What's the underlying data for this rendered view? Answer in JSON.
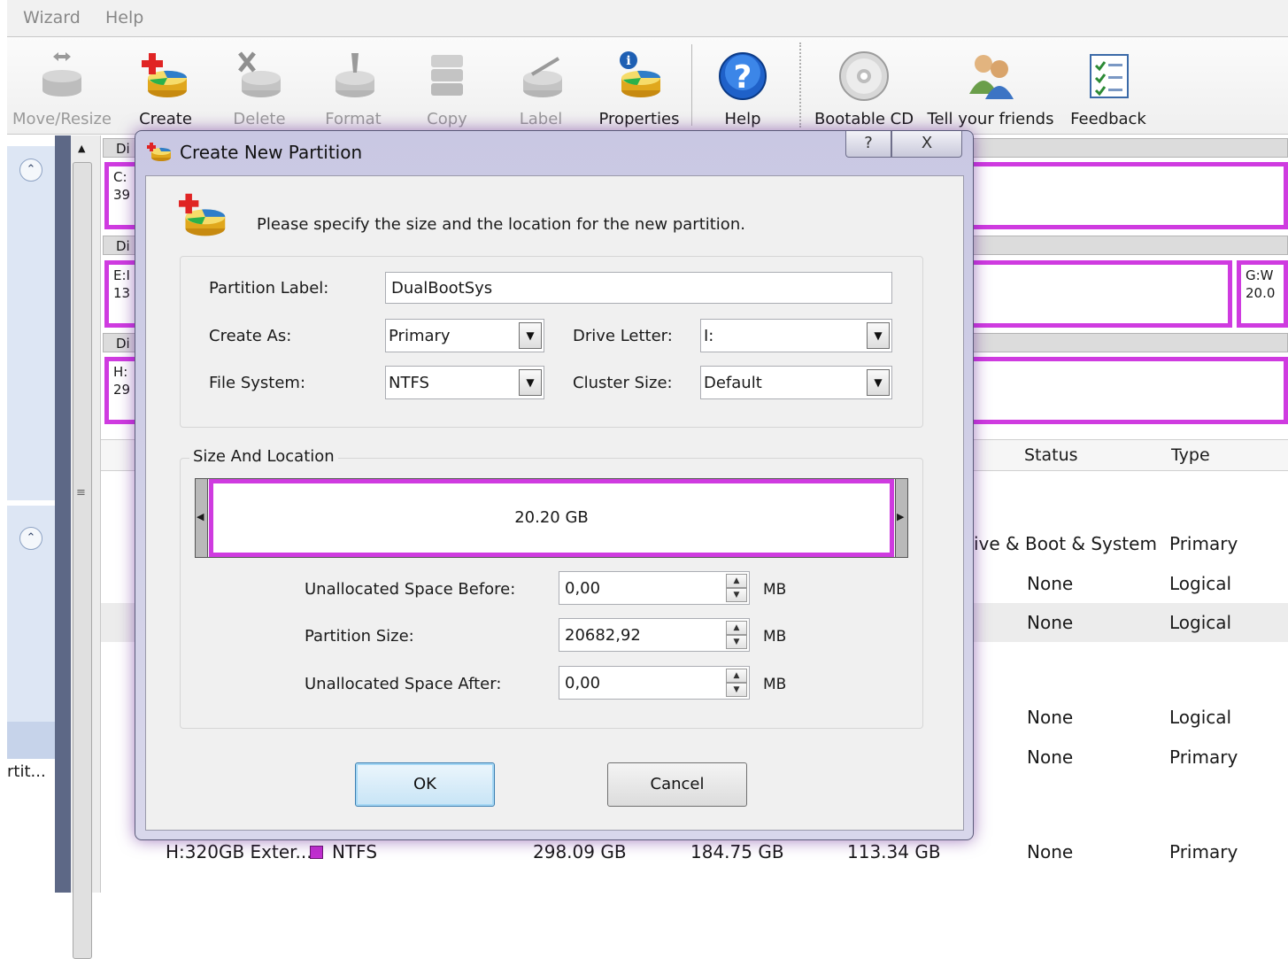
{
  "menubar": {
    "items": [
      "Wizard",
      "Help"
    ]
  },
  "toolbar": {
    "buttons": [
      {
        "label": "Move/Resize",
        "icon": "move-resize-icon",
        "enabled": false
      },
      {
        "label": "Create",
        "icon": "create-partition-icon",
        "enabled": true
      },
      {
        "label": "Delete",
        "icon": "delete-partition-icon",
        "enabled": false
      },
      {
        "label": "Format",
        "icon": "format-partition-icon",
        "enabled": false
      },
      {
        "label": "Copy",
        "icon": "copy-partition-icon",
        "enabled": false
      },
      {
        "label": "Label",
        "icon": "label-partition-icon",
        "enabled": false
      },
      {
        "label": "Properties",
        "icon": "properties-icon",
        "enabled": true
      },
      {
        "label": "Help",
        "icon": "help-icon",
        "enabled": true
      },
      {
        "label": "Bootable CD",
        "icon": "cd-icon",
        "enabled": true
      },
      {
        "label": "Tell your friends",
        "icon": "friends-icon",
        "enabled": true
      },
      {
        "label": "Feedback",
        "icon": "feedback-icon",
        "enabled": true
      }
    ]
  },
  "disk_map": {
    "headers": [
      "Di",
      "Di",
      "Di"
    ],
    "partitions": [
      {
        "line1": "C:",
        "line2": "39"
      },
      {
        "line1": "E:I",
        "line2": "13"
      },
      {
        "line1": "G:W",
        "line2": "20.0"
      },
      {
        "line1": "H:",
        "line2": "29"
      }
    ]
  },
  "left_panel": {
    "truncated_label": "rtit..."
  },
  "partition_list": {
    "columns": {
      "status": "Status",
      "type": "Type"
    },
    "rows": [
      {
        "status": "ive & Boot & System",
        "type": "Primary"
      },
      {
        "status": "None",
        "type": "Logical"
      },
      {
        "status": "None",
        "type": "Logical"
      },
      {
        "status": "None",
        "type": "Logical"
      },
      {
        "status": "None",
        "type": "Primary"
      }
    ],
    "last_row": {
      "name": "H:320GB Exter...",
      "fs": "NTFS",
      "capacity": "298.09 GB",
      "used": "184.75 GB",
      "unused": "113.34 GB",
      "status": "None",
      "type": "Primary"
    }
  },
  "dialog": {
    "title": "Create New Partition",
    "help_glyph": "?",
    "close_glyph": "X",
    "instruction": "Please specify the size and the location for the new partition.",
    "fields": {
      "partition_label": {
        "label": "Partition Label:",
        "value": "DualBootSys"
      },
      "create_as": {
        "label": "Create As:",
        "value": "Primary"
      },
      "drive_letter": {
        "label": "Drive Letter:",
        "value": "I:"
      },
      "file_system": {
        "label": "File System:",
        "value": "NTFS"
      },
      "cluster_size": {
        "label": "Cluster Size:",
        "value": "Default"
      }
    },
    "size_location": {
      "group_title": "Size And Location",
      "bar_label": "20.20 GB",
      "unallocated_before": {
        "label": "Unallocated Space Before:",
        "value": "0,00",
        "unit": "MB"
      },
      "partition_size": {
        "label": "Partition Size:",
        "value": "20682,92",
        "unit": "MB"
      },
      "unallocated_after": {
        "label": "Unallocated Space After:",
        "value": "0,00",
        "unit": "MB"
      }
    },
    "ok_label": "OK",
    "cancel_label": "Cancel"
  },
  "colors": {
    "partition_border": "#cf3be0",
    "dialog_frame": "#c9c8e3",
    "left_bar": "#5d6886"
  }
}
